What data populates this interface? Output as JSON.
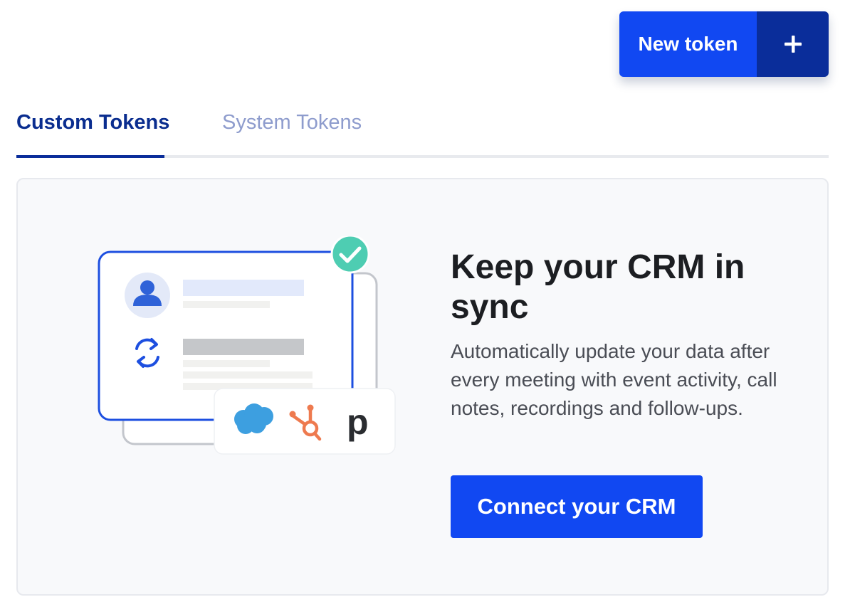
{
  "header": {
    "new_token_label": "New token"
  },
  "tabs": [
    {
      "label": "Custom Tokens",
      "active": true
    },
    {
      "label": "System Tokens",
      "active": false
    }
  ],
  "card": {
    "title": "Keep your CRM in sync",
    "body": "Automatically update your data after every meeting with event activity, call notes, recordings and follow-ups.",
    "button_label": "Connect your CRM",
    "integrations": [
      "salesforce-icon",
      "hubspot-icon",
      "pipedrive-icon"
    ],
    "pipedrive_glyph": "p"
  },
  "colors": {
    "primary": "#1148f2",
    "primary_dark": "#0a2d9a",
    "tab_active": "#0a2d8f",
    "tab_inactive": "#8e9ccd",
    "check_green": "#4ecdb2",
    "salesforce": "#3d9fe0",
    "hubspot": "#ee7a4f"
  }
}
